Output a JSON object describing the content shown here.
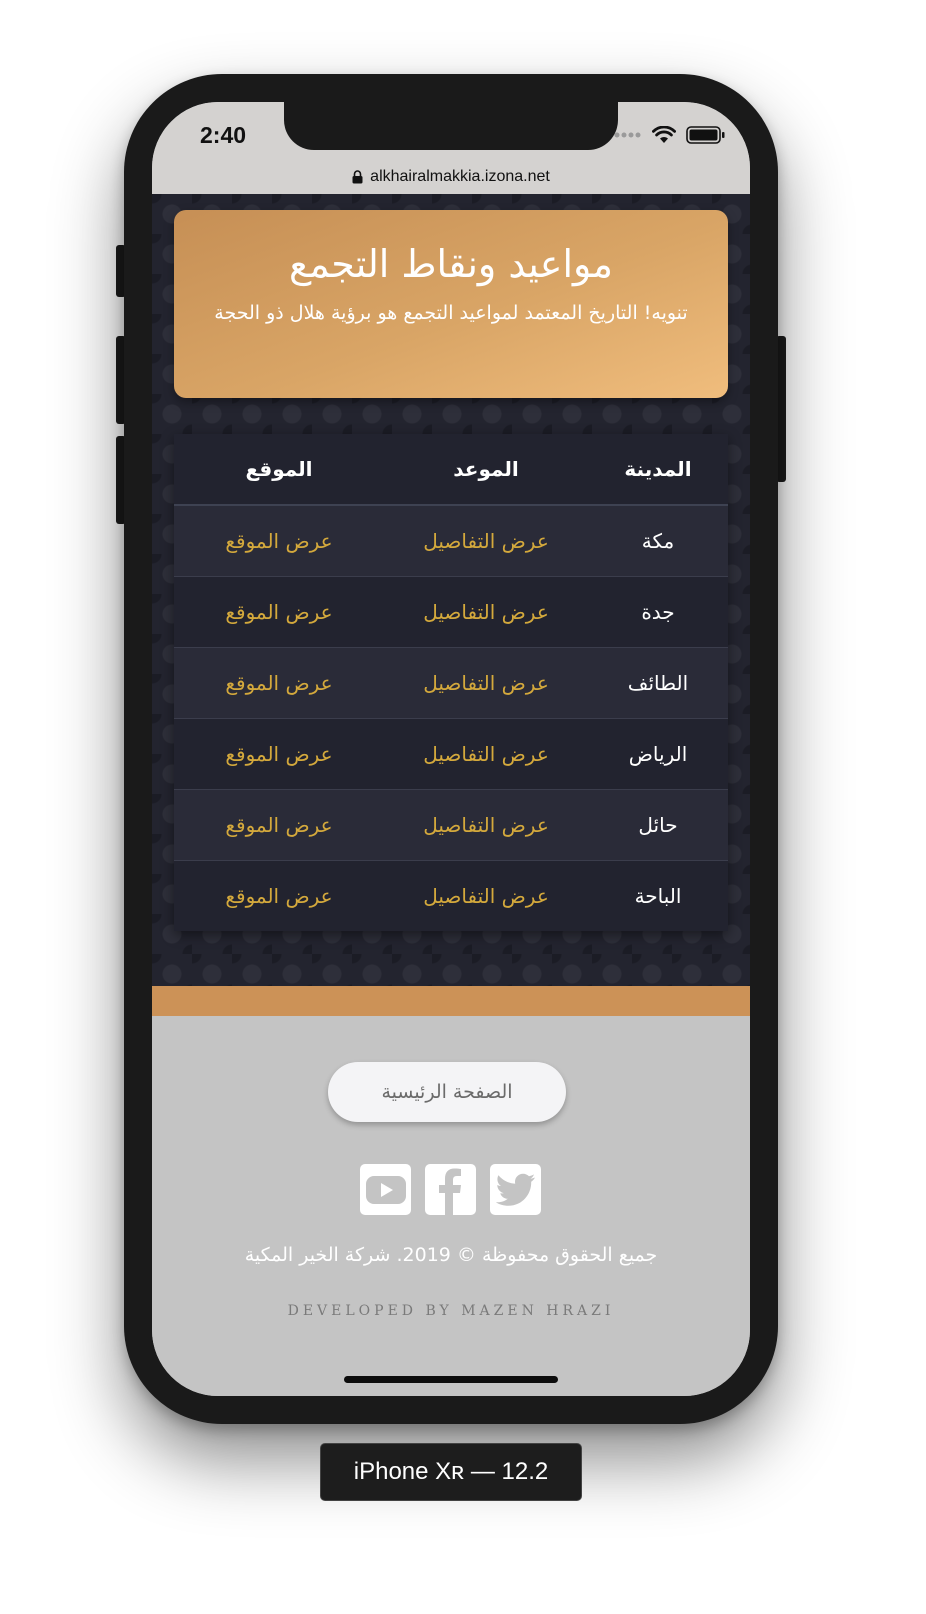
{
  "status_bar": {
    "time": "2:40",
    "icons": [
      "signal-dots-icon",
      "wifi-icon",
      "battery-icon"
    ]
  },
  "address_bar": {
    "url": "alkhairalmakkia.izona.net",
    "icon": "lock-icon"
  },
  "hero": {
    "title": "مواعيد ونقاط التجمع",
    "note": "تنويه! التاريخ المعتمد لمواعيد التجمع هو برؤية هلال ذو الحجة"
  },
  "table": {
    "headers": [
      "المدينة",
      "الموعد",
      "الموقع"
    ],
    "rows": [
      {
        "city": "مكة",
        "details": "عرض التفاصيل",
        "location": "عرض الموقع"
      },
      {
        "city": "جدة",
        "details": "عرض التفاصيل",
        "location": "عرض الموقع"
      },
      {
        "city": "الطائف",
        "details": "عرض التفاصيل",
        "location": "عرض الموقع"
      },
      {
        "city": "الرياض",
        "details": "عرض التفاصيل",
        "location": "عرض الموقع"
      },
      {
        "city": "حائل",
        "details": "عرض التفاصيل",
        "location": "عرض الموقع"
      },
      {
        "city": "الباحة",
        "details": "عرض التفاصيل",
        "location": "عرض الموقع"
      }
    ]
  },
  "footer": {
    "home_button": "الصفحة الرئيسية",
    "social_icons": [
      "youtube-icon",
      "facebook-icon",
      "twitter-icon"
    ],
    "copyright": "جميع الحقوق محفوظة © 2019. شركة الخير المكية",
    "developer": "DEVELOPED BY MAZEN HRAZI"
  },
  "device_label": "iPhone Xʀ — 12.2",
  "colors": {
    "hero_gradient_start": "#c68f55",
    "hero_gradient_end": "#f0bd7d",
    "link_gold": "#d4a93c",
    "content_bg": "#23242f",
    "footer_bg": "#c4c4c4",
    "accent_band": "#cc9257"
  }
}
